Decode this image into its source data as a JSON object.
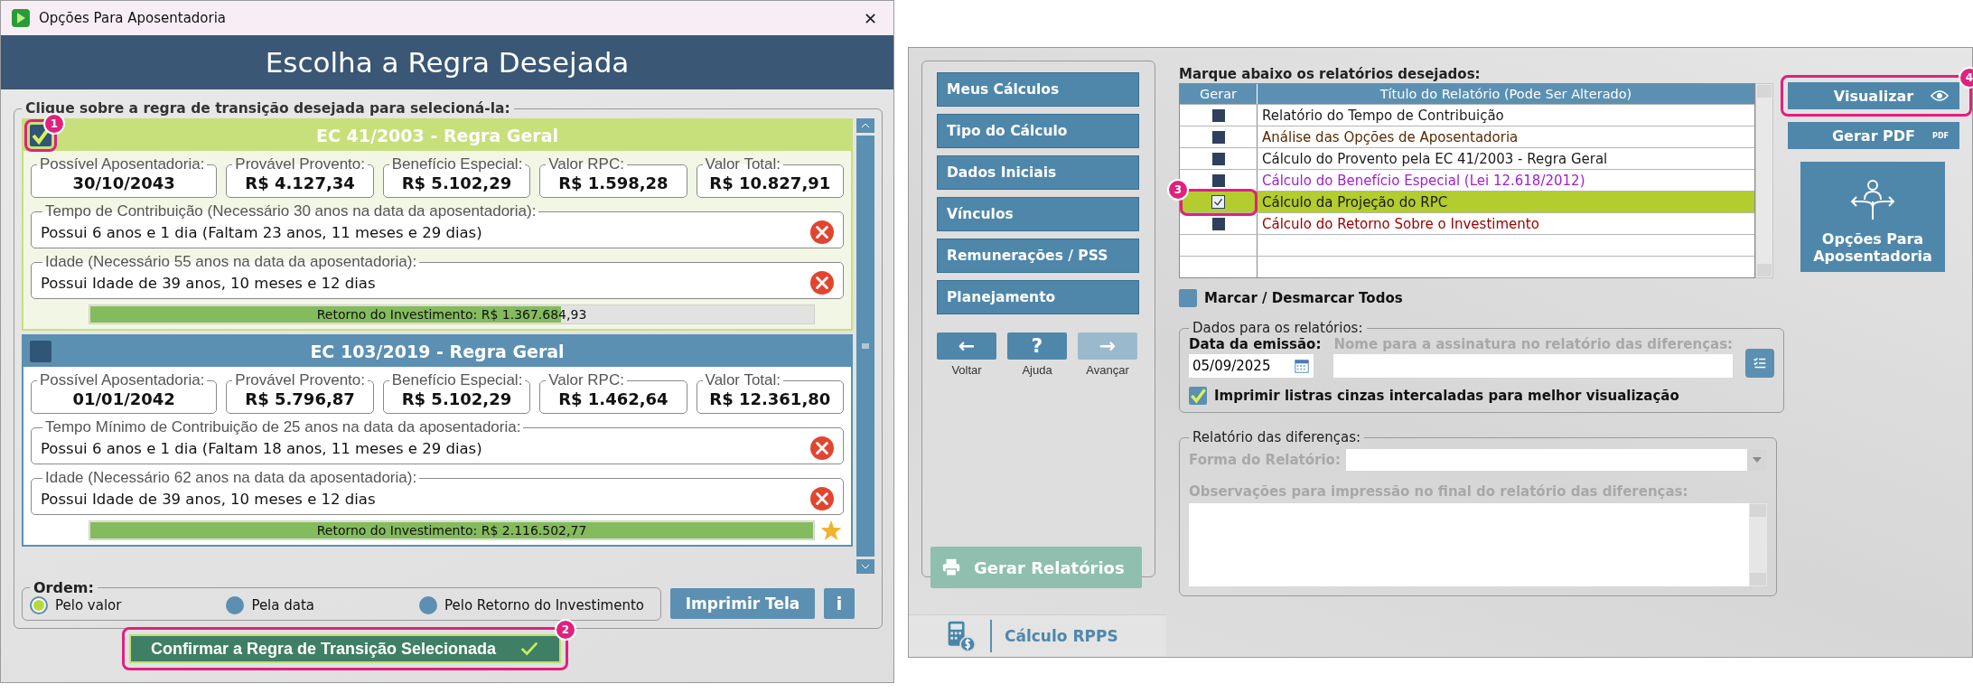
{
  "left_window": {
    "title": "Opções Para Aposentadoria",
    "close": "✕",
    "header": "Escolha a Regra Desejada",
    "group_label": "Clique sobre a regra de transição desejada para selecioná-la:",
    "rules": [
      {
        "title": "EC 41/2003 - Regra Geral",
        "selected": true,
        "callout": "1",
        "summary": [
          {
            "label": "Possível Aposentadoria:",
            "value": "30/10/2043"
          },
          {
            "label": "Provável Provento:",
            "value": "R$ 4.127,34"
          },
          {
            "label": "Benefício Especial:",
            "value": "R$ 5.102,29"
          },
          {
            "label": "Valor RPC:",
            "value": "R$ 1.598,28"
          },
          {
            "label": "Valor Total:",
            "value": "R$ 10.827,91"
          }
        ],
        "requirements": [
          {
            "label": "Tempo de Contribuição (Necessário 30 anos na data da aposentadoria):",
            "text": "Possui 6 anos e 1 dia (Faltam 23 anos, 11 meses e 29 dias)",
            "met": false
          },
          {
            "label": "Idade (Necessário 55 anos na data da aposentadoria):",
            "text": "Possui Idade de 39 anos, 10 meses e 12 dias",
            "met": false
          }
        ],
        "return_label": "Retorno do Investimento: R$ 1.367.684,93",
        "level": 0.65,
        "best": false
      },
      {
        "title": "EC 103/2019 - Regra Geral",
        "selected": false,
        "summary": [
          {
            "label": "Possível Aposentadoria:",
            "value": "01/01/2042"
          },
          {
            "label": "Provável Provento:",
            "value": "R$ 5.796,87"
          },
          {
            "label": "Benefício Especial:",
            "value": "R$ 5.102,29"
          },
          {
            "label": "Valor RPC:",
            "value": "R$ 1.462,64"
          },
          {
            "label": "Valor Total:",
            "value": "R$ 12.361,80"
          }
        ],
        "requirements": [
          {
            "label": "Tempo Mínimo de Contribuição de 25 anos na data da aposentadoria:",
            "text": "Possui 6 anos e 1 dia (Faltam 18 anos, 11 meses e 29 dias)",
            "met": false
          },
          {
            "label": "Idade (Necessário 62 anos na data da aposentadoria):",
            "text": "Possui Idade de 39 anos, 10 meses e 12 dias",
            "met": false
          }
        ],
        "return_label": "Retorno do Investimento: R$ 2.116.502,77",
        "level": 1,
        "best": true
      }
    ],
    "order": {
      "label": "Ordem:",
      "options": [
        {
          "label": "Pelo valor",
          "selected": true
        },
        {
          "label": "Pela data",
          "selected": false
        },
        {
          "label": "Pelo Retorno do Investimento",
          "selected": false
        }
      ]
    },
    "print_button": "Imprimir Tela",
    "info_button": "i",
    "confirm": {
      "label": "Confirmar a Regra de Transição Selecionada",
      "callout": "2"
    }
  },
  "right_window": {
    "nav_items": [
      "Meus Cálculos",
      "Tipo do Cálculo",
      "Dados Iniciais",
      "Vínculos",
      "Remunerações / PSS",
      "Planejamento"
    ],
    "nav_buttons": [
      {
        "glyph": "←",
        "label": "Voltar",
        "disabled": false
      },
      {
        "glyph": "?",
        "label": "Ajuda",
        "disabled": false
      },
      {
        "glyph": "→",
        "label": "Avançar",
        "disabled": true
      }
    ],
    "generate_button": {
      "label": "Gerar Relatórios",
      "disabled": true
    },
    "footer": "Cálculo RPPS",
    "reports_label": "Marque abaixo os relatórios desejados:",
    "table": {
      "columns": [
        "Gerar",
        "Título do Relatório (Pode Ser Alterado)"
      ],
      "rows": [
        {
          "title": "Relatório do Tempo de Contribuição",
          "checked": false,
          "selected": false,
          "color": "#1a1a1a"
        },
        {
          "title": "Análise das Opções de Aposentadoria",
          "checked": false,
          "selected": false,
          "color": "#5a2a00"
        },
        {
          "title": "Cálculo do Provento pela EC 41/2003 - Regra Geral",
          "checked": false,
          "selected": false,
          "color": "#1a1a1a"
        },
        {
          "title": "Cálculo do Benefício Especial (Lei 12.618/2012)",
          "checked": false,
          "selected": false,
          "color": "#a020d0"
        },
        {
          "title": "Cálculo da Projeção do RPC",
          "checked": true,
          "selected": true,
          "color": "#1a1a1a",
          "callout": "3"
        },
        {
          "title": "Cálculo do Retorno Sobre o Investimento",
          "checked": false,
          "selected": false,
          "color": "#a00000"
        }
      ]
    },
    "toggle_all": {
      "label": "Marcar / Desmarcar Todos",
      "checked": false
    },
    "data_group": {
      "label": "Dados para os relatórios:",
      "date_label": "Data da emissão:",
      "date_value": "05/09/2025",
      "name_label": "Nome para a assinatura no relatório das diferenças:",
      "stripes": {
        "label": "Imprimir listras cinzas intercaladas para melhor visualização",
        "checked": true
      }
    },
    "diff_group": {
      "label": "Relatório das diferenças:",
      "form_label": "Forma do Relatório:",
      "notes_label": "Observações para impressão no final do relatório das diferenças:"
    },
    "visualize": {
      "label": "Visualizar",
      "callout": "4"
    },
    "pdf": {
      "label": "Gerar PDF",
      "badge": "PDF"
    },
    "options_button": "Opções Para Aposentadoria"
  }
}
